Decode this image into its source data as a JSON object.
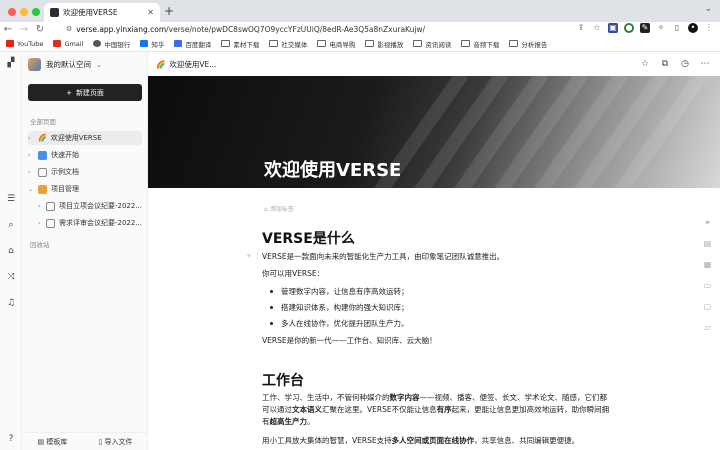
{
  "browser": {
    "tab_title": "欢迎使用VERSE",
    "url_host": "verse.app.yinxiang.com",
    "url_path": "/verse/note/pwDC8swOQ7O9yccYFzUUiQ/8edR-Ae3Q5a8nZxuraKujw/",
    "bookmarks": [
      {
        "label": "YouTube",
        "icon": "youtube-icon",
        "color": "#e62117"
      },
      {
        "label": "Gmail",
        "icon": "gmail-icon",
        "color": "#d93025"
      },
      {
        "label": "中国银行",
        "icon": "globe-icon",
        "color": "#555555"
      },
      {
        "label": "知乎",
        "icon": "zhihu-icon",
        "color": "#1772f6"
      },
      {
        "label": "百度翻译",
        "icon": "baidu-translate-icon",
        "color": "#3a6de6"
      },
      {
        "label": "素材下载",
        "icon": "folder-icon"
      },
      {
        "label": "社交媒体",
        "icon": "folder-icon"
      },
      {
        "label": "电商导购",
        "icon": "folder-icon"
      },
      {
        "label": "影视播放",
        "icon": "folder-icon"
      },
      {
        "label": "资讯阅读",
        "icon": "folder-icon"
      },
      {
        "label": "音频下载",
        "icon": "folder-icon"
      },
      {
        "label": "分析报告",
        "icon": "folder-icon"
      }
    ]
  },
  "sidebar": {
    "workspace_name": "我的默认空间",
    "new_page_label": "新建页面",
    "all_pages_label": "全部页面",
    "trash_label": "回收站",
    "items": [
      {
        "label": "欢迎使用VERSE",
        "icon": "rainbow-icon",
        "active": true
      },
      {
        "label": "快速开始",
        "icon": "video-icon"
      },
      {
        "label": "示例文档",
        "icon": "doc-icon"
      },
      {
        "label": "项目管理",
        "icon": "folder-icon"
      },
      {
        "label": "项目立项会议纪要-2022...",
        "icon": "doc-icon"
      },
      {
        "label": "需求评审会议纪要-2022...",
        "icon": "doc-icon"
      }
    ],
    "templates_label": "模板库",
    "import_label": "导入文件"
  },
  "document": {
    "breadcrumb": "欢迎使用VE...",
    "cover_title": "欢迎使用VERSE",
    "add_tag_label": "添加标签",
    "h1_what": "VERSE是什么",
    "p_intro": "VERSE是一款面向未来的智能化生产力工具，由印象笔记团队诚意推出。",
    "p_can": "你可以用VERSE：",
    "bullets": [
      "管理数字内容，让信息有序高效运转；",
      "搭建知识体系，构建你的强大知识库；",
      "多人在线协作，优化提升团队生产力。"
    ],
    "p_summary": "VERSE是你的新一代——工作台、知识库、云大脑！",
    "h1_workbench": "工作台",
    "p_work_1a": "工作、学习、生活中，不管何种媒介的",
    "p_work_1b": "数字内容",
    "p_work_1c": "——视频、播客、便签、长文、学术论文、随感，它们都可以通过",
    "p_work_1d": "文本语义",
    "p_work_1e": "汇聚在这里。VERSE不仅能让信息",
    "p_work_1f": "有序",
    "p_work_1g": "起来，更能让信息更加高效地运转，助你瞬间拥有",
    "p_work_1h": "超高生产力",
    "p_work_1i": "。",
    "p_work_2a": "用小工具放大集体的智慧，VERSE支持",
    "p_work_2b": "多人空间或页面在线协作",
    "p_work_2c": "，共享信息、共同编辑更便捷。"
  }
}
